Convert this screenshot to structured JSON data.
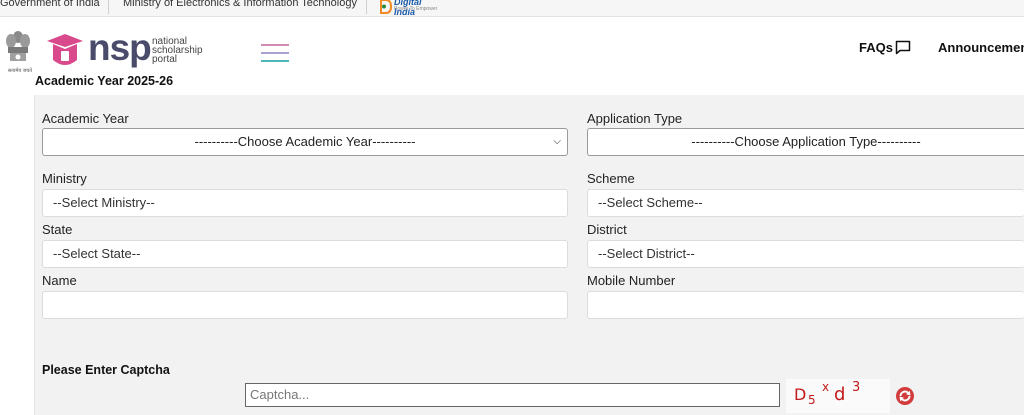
{
  "gov_bar": {
    "gov_label": "Government of India",
    "ministry_label": "Ministry of Electronics & Information Technology",
    "digital_india": "Digital India",
    "digital_india_tagline": "Power To Empower"
  },
  "header": {
    "logo_word": "nsp",
    "logo_sub_1": "national",
    "logo_sub_2": "scholarship",
    "logo_sub_3": "portal",
    "emblem_caption": "सत्यमेव जयते",
    "academic_year_label": "Academic Year 2025-26",
    "faqs": "FAQs",
    "announcements": "Announcements"
  },
  "form": {
    "academic_year": {
      "label": "Academic Year",
      "value": "----------Choose Academic Year----------"
    },
    "application_type": {
      "label": "Application Type",
      "value": "----------Choose Application Type----------"
    },
    "ministry": {
      "label": "Ministry",
      "value": "--Select Ministry--"
    },
    "scheme": {
      "label": "Scheme",
      "value": "--Select Scheme--"
    },
    "state": {
      "label": "State",
      "value": "--Select State--"
    },
    "district": {
      "label": "District",
      "value": "--Select District--"
    },
    "name": {
      "label": "Name",
      "value": ""
    },
    "mobile": {
      "label": "Mobile Number",
      "value": ""
    }
  },
  "captcha": {
    "title": "Please Enter Captcha",
    "placeholder": "Captcha...",
    "chars": [
      "D",
      "5",
      "x",
      "d",
      "3"
    ]
  },
  "colors": {
    "brand_pink": "#d84a8b",
    "brand_navy": "#4a4a6a",
    "captcha_red": "#c11a1a",
    "panel_bg": "#f2f2f2"
  }
}
